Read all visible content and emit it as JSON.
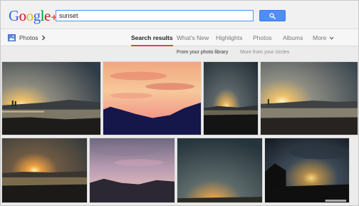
{
  "header": {
    "logo_letters": [
      "G",
      "o",
      "o",
      "g",
      "l",
      "e"
    ],
    "logo_plus": "+",
    "search_value": "sunset"
  },
  "nav": {
    "photos_label": "Photos",
    "tabs": [
      "Search results",
      "What's New",
      "Highlights",
      "Photos",
      "Albums",
      "More"
    ]
  },
  "filters": {
    "from_library": "From your photo library",
    "from_circles": "More from your circles"
  },
  "colors": {
    "google_blue": "#3369e8",
    "google_red": "#d50f25",
    "google_yellow": "#eeb211",
    "google_green": "#009925",
    "accent_red": "#dd4b39",
    "search_blue": "#4d8ff5"
  },
  "icons": {
    "search": "search-icon",
    "photos": "photos-icon",
    "chevron_right": "chevron-right-icon",
    "chevron_down": "chevron-down-icon"
  }
}
